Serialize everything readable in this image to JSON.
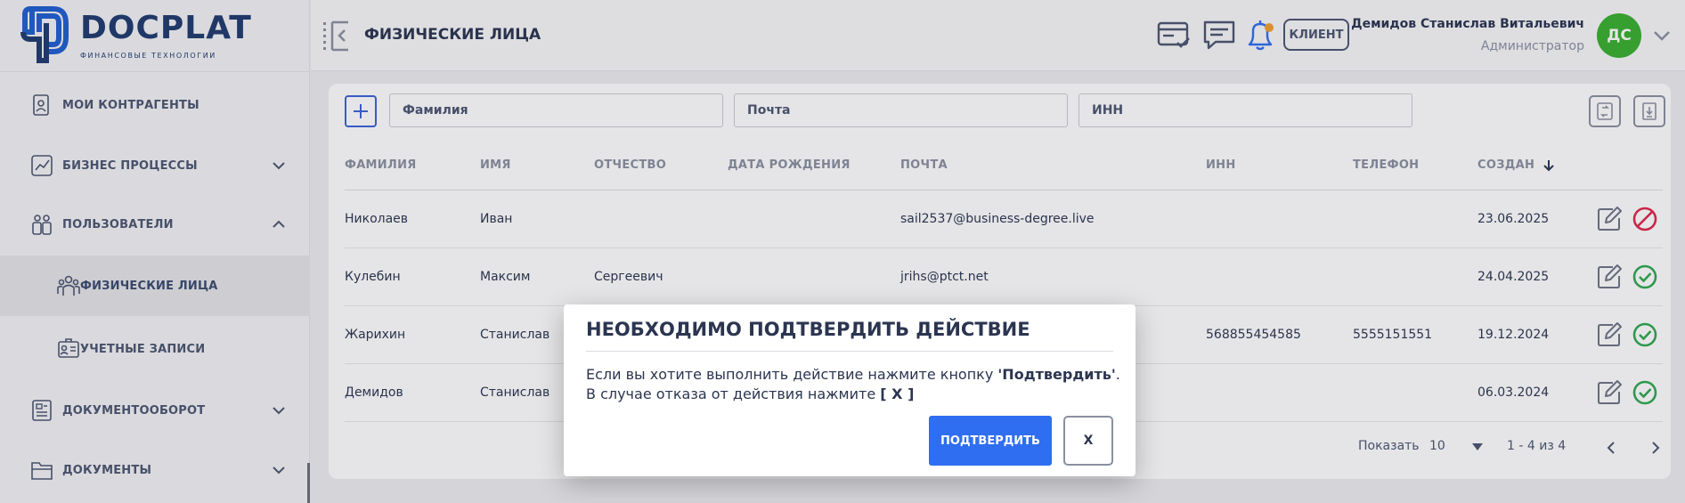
{
  "logo": {
    "name": "DOCPLAT",
    "subtitle": "ФИНАНСОВЫЕ ТЕХНОЛОГИИ"
  },
  "sidebar": {
    "items": [
      {
        "label": "МОИ КОНТРАГЕНТЫ",
        "icon": "contractors-icon"
      },
      {
        "label": "БИЗНЕС ПРОЦЕССЫ",
        "icon": "chart-icon",
        "expandable": true,
        "expanded": false
      },
      {
        "label": "ПОЛЬЗОВАТЕЛИ",
        "icon": "users-icon",
        "expandable": true,
        "expanded": true
      },
      {
        "label": "ФИЗИЧЕСКИЕ ЛИЦА",
        "icon": "people-icon",
        "sub": true,
        "active": true
      },
      {
        "label": "УЧЕТНЫЕ ЗАПИСИ",
        "icon": "id-card-icon",
        "sub": true
      },
      {
        "label": "ДОКУМЕНТООБОРОТ",
        "icon": "doc-flow-icon",
        "expandable": true,
        "expanded": false
      },
      {
        "label": "ДОКУМЕНТЫ",
        "icon": "folder-icon",
        "expandable": true,
        "expanded": false
      }
    ]
  },
  "header": {
    "title": "ФИЗИЧЕСКИЕ ЛИЦА",
    "client_label": "КЛИЕНТ",
    "user_name": "Демидов Станислав Витальевич",
    "user_role": "Администратор",
    "avatar_initials": "ДС",
    "avatar_color": "#38b02e"
  },
  "filters": {
    "lastname_placeholder": "Фамилия",
    "email_placeholder": "Почта",
    "inn_placeholder": "ИНН"
  },
  "table": {
    "columns": [
      "ФАМИЛИЯ",
      "ИМЯ",
      "ОТЧЕСТВО",
      "ДАТА РОЖДЕНИЯ",
      "ПОЧТА",
      "ИНН",
      "ТЕЛЕФОН",
      "СОЗДАН"
    ],
    "sort_column": "СОЗДАН",
    "rows": [
      {
        "lastname": "Николаев",
        "firstname": "Иван",
        "middlename": "",
        "birthdate": "",
        "email": "sail2537@business-degree.live",
        "inn": "",
        "phone": "",
        "created": "23.06.2025",
        "status": "blocked"
      },
      {
        "lastname": "Кулебин",
        "firstname": "Максим",
        "middlename": "Сергеевич",
        "birthdate": "",
        "email": "jrihs@ptct.net",
        "inn": "",
        "phone": "",
        "created": "24.04.2025",
        "status": "active"
      },
      {
        "lastname": "Жарихин",
        "firstname": "Станислав",
        "middlename": "",
        "birthdate": "",
        "email": "",
        "inn": "568855454585",
        "phone": "5555151551",
        "created": "19.12.2024",
        "status": "active"
      },
      {
        "lastname": "Демидов",
        "firstname": "Станислав",
        "middlename": "",
        "birthdate": "",
        "email": "",
        "inn": "",
        "phone": "",
        "created": "06.03.2024",
        "status": "active"
      }
    ]
  },
  "pagination": {
    "show_label": "Показать",
    "page_size": "10",
    "range": "1 - 4 из 4"
  },
  "modal": {
    "title": "НЕОБХОДИМО ПОДТВЕРДИТЬ ДЕЙСТВИЕ",
    "line1_prefix": "Если вы хотите выполнить действие нажмите кнопку ",
    "line1_bold": "'Подтвердить'",
    "line1_suffix": ".",
    "line2_prefix": "В случае отказа от действия нажмите ",
    "line2_bold": "[ X ]",
    "confirm_label": "ПОДТВЕРДИТЬ",
    "cancel_label": "X"
  },
  "colors": {
    "accent": "#2f6ef0",
    "brand": "#1f3b6e",
    "active_status": "#2fa84f",
    "blocked_status": "#e0264a",
    "notification": "#f0a030"
  }
}
